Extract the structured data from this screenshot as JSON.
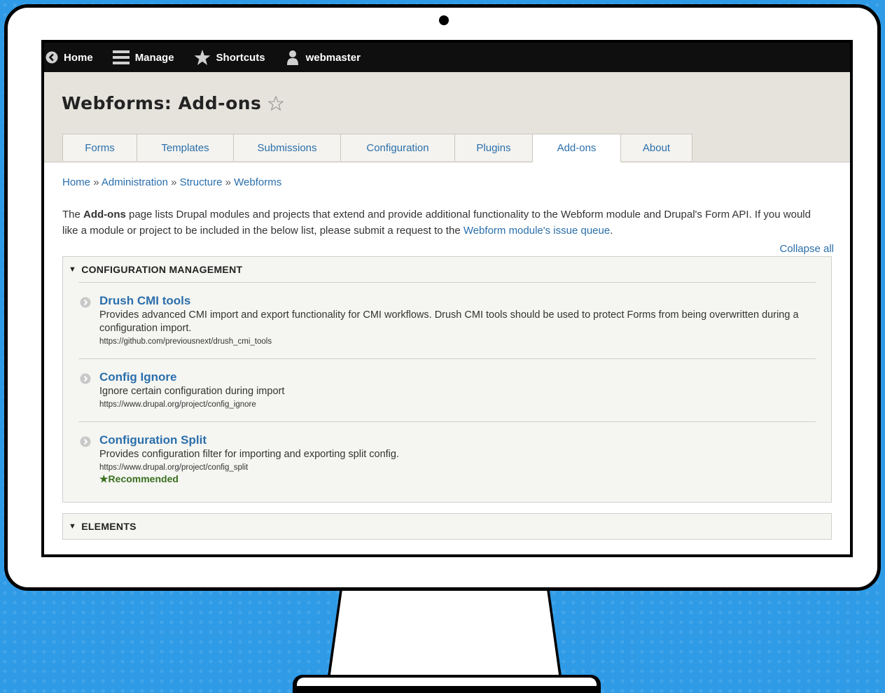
{
  "toolbar": {
    "home": "Home",
    "manage": "Manage",
    "shortcuts": "Shortcuts",
    "user": "webmaster"
  },
  "page": {
    "title": "Webforms: Add-ons"
  },
  "tabs": [
    {
      "label": "Forms"
    },
    {
      "label": "Templates"
    },
    {
      "label": "Submissions"
    },
    {
      "label": "Configuration"
    },
    {
      "label": "Plugins"
    },
    {
      "label": "Add-ons"
    },
    {
      "label": "About"
    }
  ],
  "breadcrumb": {
    "items": [
      "Home",
      "Administration",
      "Structure",
      "Webforms"
    ],
    "separator": "»"
  },
  "intro": {
    "part1": "The ",
    "bold": "Add-ons",
    "part2": " page lists Drupal modules and projects that extend and provide additional functionality to the Webform module and Drupal's Form API. If you would like a module or project to be included in the below list, please submit a request to the ",
    "link": "Webform module's issue queue",
    "part3": "."
  },
  "collapse_all": "Collapse all",
  "sections": [
    {
      "title": "CONFIGURATION MANAGEMENT",
      "items": [
        {
          "title": "Drush CMI tools",
          "description": "Provides advanced CMI import and export functionality for CMI workflows. Drush CMI tools should be used to protect Forms from being overwritten during a configuration import.",
          "url": "https://github.com/previousnext/drush_cmi_tools"
        },
        {
          "title": "Config Ignore",
          "description": "Ignore certain configuration during import",
          "url": "https://www.drupal.org/project/config_ignore"
        },
        {
          "title": "Configuration Split",
          "description": "Provides configuration filter for importing and exporting split config.",
          "url": "https://www.drupal.org/project/config_split",
          "badge": "★Recommended"
        }
      ]
    },
    {
      "title": "ELEMENTS"
    }
  ],
  "colors": {
    "background": "#2f9be6",
    "toolbar": "#0f0f0f",
    "header": "#e5e3dc",
    "link": "#2b6fab",
    "recommended": "#3a6f1e"
  }
}
